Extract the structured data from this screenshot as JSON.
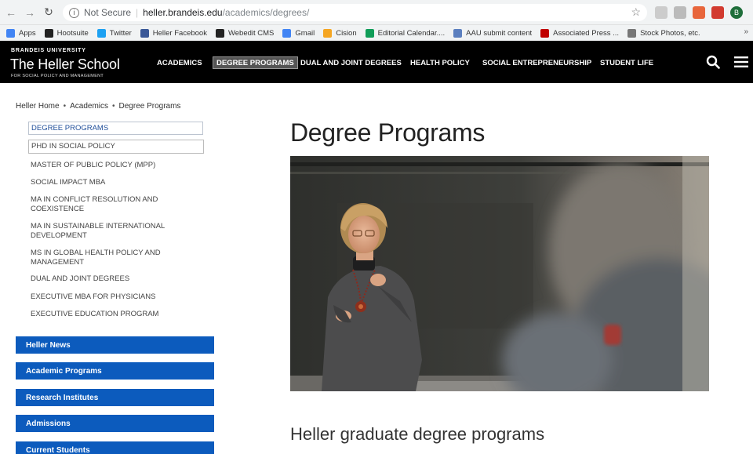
{
  "browser": {
    "not_secure": "Not Secure",
    "url_host": "heller.brandeis.edu",
    "url_path": "/academics/degrees/",
    "avatar_letter": "B",
    "bookmarks": [
      {
        "label": "Apps",
        "icon": "apps-grid-icon",
        "color": "#4285f4"
      },
      {
        "label": "Hootsuite",
        "icon": "hootsuite-owl-icon",
        "color": "#222222"
      },
      {
        "label": "Twitter",
        "icon": "twitter-bird-icon",
        "color": "#1da1f2"
      },
      {
        "label": "Heller Facebook",
        "icon": "facebook-icon",
        "color": "#3b5998"
      },
      {
        "label": "Webedit CMS",
        "icon": "webedit-c-icon",
        "color": "#222222"
      },
      {
        "label": "Gmail",
        "icon": "google-g-icon",
        "color": "#4285f4"
      },
      {
        "label": "Cision",
        "icon": "cision-icon",
        "color": "#f5a623"
      },
      {
        "label": "Editorial Calendar....",
        "icon": "sheets-icon",
        "color": "#0f9d58"
      },
      {
        "label": "AAU submit content",
        "icon": "aau-icon",
        "color": "#5b7fbf"
      },
      {
        "label": "Associated Press ...",
        "icon": "ap-icon",
        "color": "#c00000"
      },
      {
        "label": "Stock Photos, etc.",
        "icon": "folder-icon",
        "color": "#777777"
      }
    ],
    "more_bookmarks": "»"
  },
  "header": {
    "university": "BRANDEIS UNIVERSITY",
    "school": "The Heller School",
    "tagline": "FOR SOCIAL POLICY AND MANAGEMENT",
    "nav": [
      {
        "label": "ACADEMICS",
        "active": false
      },
      {
        "label": "DEGREE PROGRAMS",
        "active": true
      },
      {
        "label": "DUAL AND JOINT DEGREES",
        "active": false
      },
      {
        "label": "HEALTH POLICY",
        "active": false
      },
      {
        "label": "SOCIAL ENTREPRENEURSHIP",
        "active": false
      },
      {
        "label": "STUDENT LIFE",
        "active": false
      }
    ]
  },
  "breadcrumb": [
    "Heller Home",
    "Academics",
    "Degree Programs"
  ],
  "sidenav": [
    {
      "label": "DEGREE PROGRAMS",
      "state": "selected"
    },
    {
      "label": "PHD IN SOCIAL POLICY",
      "state": "boxed"
    },
    {
      "label": "MASTER OF PUBLIC POLICY (MPP)",
      "state": ""
    },
    {
      "label": "SOCIAL IMPACT MBA",
      "state": ""
    },
    {
      "label": "MA IN CONFLICT RESOLUTION AND COEXISTENCE",
      "state": ""
    },
    {
      "label": "MA IN SUSTAINABLE INTERNATIONAL DEVELOPMENT",
      "state": ""
    },
    {
      "label": "MS IN GLOBAL HEALTH POLICY AND MANAGEMENT",
      "state": ""
    },
    {
      "label": "DUAL AND JOINT DEGREES",
      "state": ""
    },
    {
      "label": "EXECUTIVE MBA FOR PHYSICIANS",
      "state": ""
    },
    {
      "label": "EXECUTIVE EDUCATION PROGRAM",
      "state": ""
    }
  ],
  "quicklinks": [
    "Heller News",
    "Academic Programs",
    "Research Institutes",
    "Admissions",
    "Current Students"
  ],
  "main": {
    "title": "Degree Programs",
    "subheading": "Heller graduate degree programs"
  },
  "colors": {
    "header_bg": "#000000",
    "quicklink_bg": "#0c5bbd",
    "sidenav_selected": "#1f4e9a"
  }
}
